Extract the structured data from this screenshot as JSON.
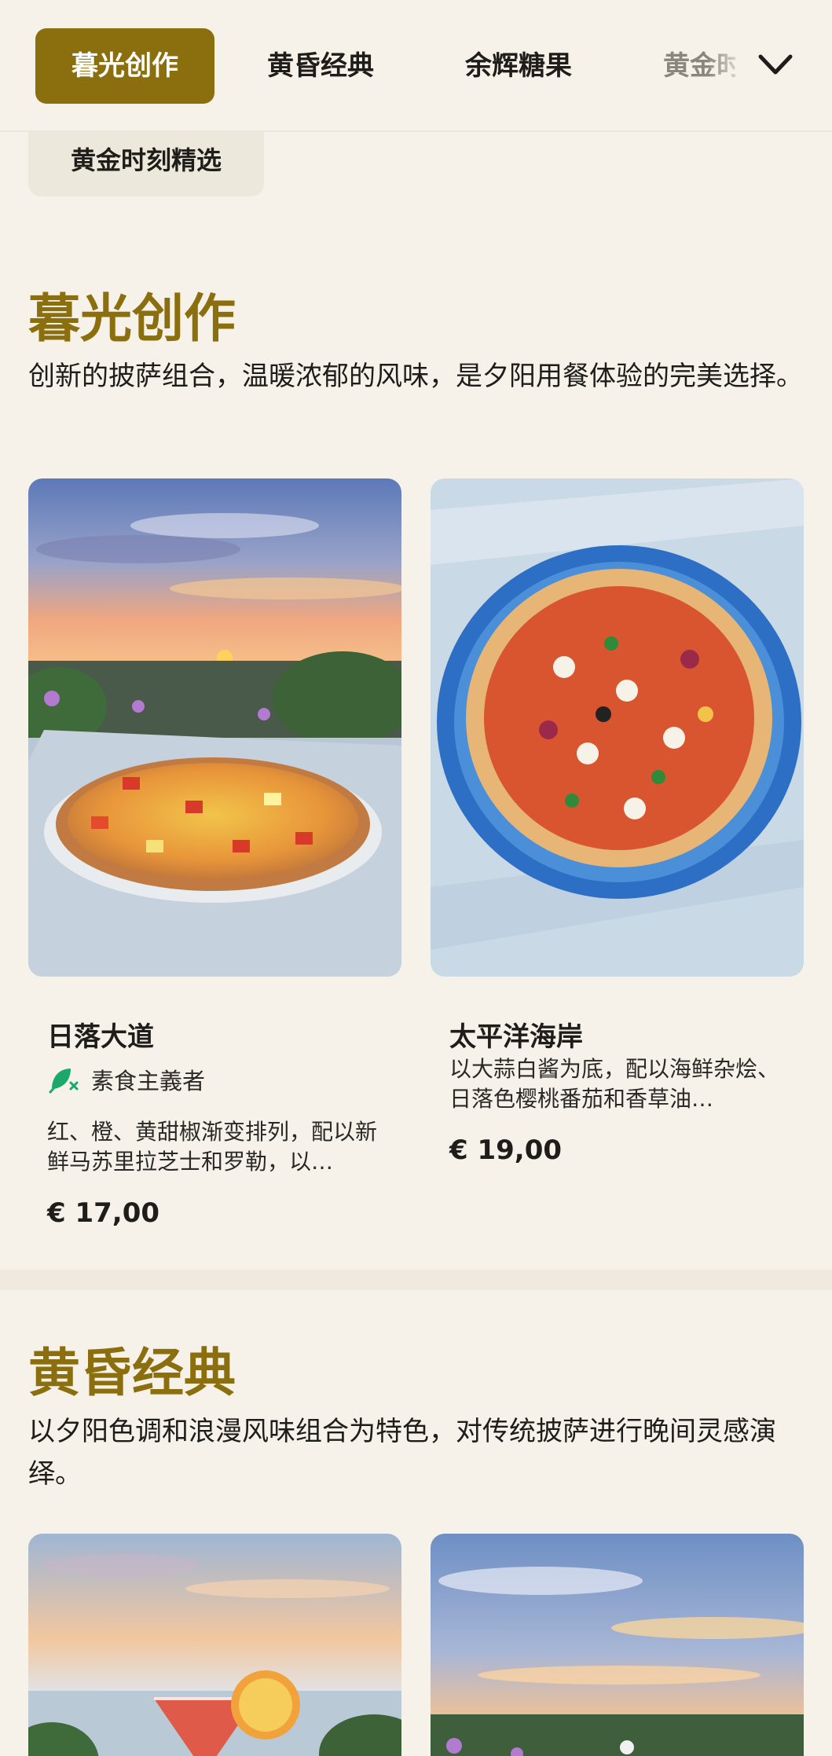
{
  "tabs": [
    {
      "label": "暮光创作",
      "active": true
    },
    {
      "label": "黄昏经典",
      "active": false
    },
    {
      "label": "余辉糖果",
      "active": false
    },
    {
      "label": "黄金时",
      "active": false
    }
  ],
  "overflow_chip": "黄金时刻精选",
  "sections": [
    {
      "title": "暮光创作",
      "description": "创新的披萨组合，温暖浓郁的风味，是夕阳用餐体验的完美选择。",
      "items": [
        {
          "name": "日落大道",
          "diet_label": "素食主義者",
          "description": "红、橙、黄甜椒渐变排列，配以新鲜马苏里拉芝士和罗勒，以…",
          "price": "€ 17,00"
        },
        {
          "name": "太平洋海岸",
          "description": "以大蒜白酱为底，配以海鲜杂烩、日落色樱桃番茄和香草油…",
          "price": "€ 19,00"
        }
      ]
    },
    {
      "title": "黄昏经典",
      "description": "以夕阳色调和浪漫风味组合为特色，对传统披萨进行晚间灵感演绎。"
    }
  ],
  "colors": {
    "accent": "#8b6e0d",
    "background": "#f6f2ea",
    "diet_icon": "#1aa86b"
  },
  "icons": {
    "dropdown": "chevron-down-icon",
    "diet": "vegetarian-leaf-icon"
  }
}
